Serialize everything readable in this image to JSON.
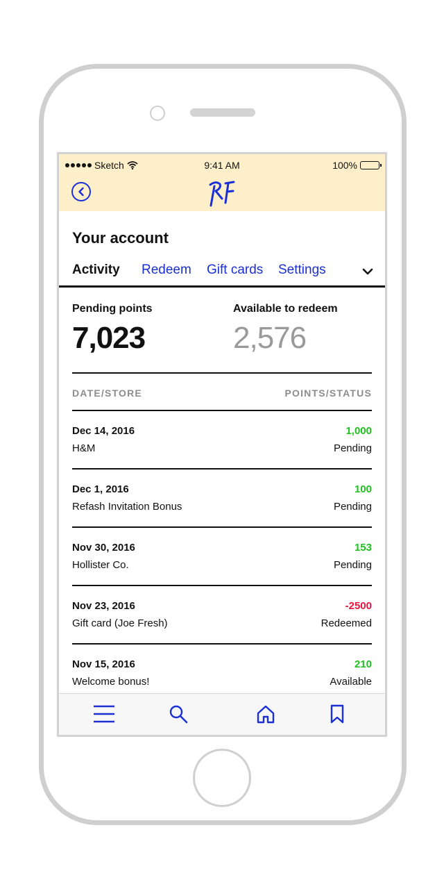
{
  "colors": {
    "accent": "#1a2fd6",
    "header_bg": "#fcefca",
    "positive": "#1fc21f",
    "negative": "#e8143c",
    "muted": "#9a9a9a"
  },
  "status_bar": {
    "carrier": "Sketch",
    "time": "9:41 AM",
    "battery": "100%",
    "battery_level": 1.0
  },
  "header": {
    "back_icon": "chevron-left-circle-icon",
    "logo_icon": "rf-logo-icon"
  },
  "page": {
    "title": "Your account"
  },
  "tabs": [
    {
      "label": "Activity",
      "active": true
    },
    {
      "label": "Redeem",
      "active": false
    },
    {
      "label": "Gift cards",
      "active": false
    },
    {
      "label": "Settings",
      "active": false
    }
  ],
  "tabs_more_icon": "chevron-down-icon",
  "summary": {
    "pending_label": "Pending points",
    "pending_value": "7,023",
    "available_label": "Available to redeem",
    "available_value": "2,576"
  },
  "table": {
    "columns": [
      "DATE/STORE",
      "POINTS/STATUS"
    ],
    "rows": [
      {
        "date": "Dec 14, 2016",
        "store": "H&M",
        "points": "1,000",
        "status": "Pending",
        "tone": "positive"
      },
      {
        "date": "Dec 1, 2016",
        "store": "Refash Invitation Bonus",
        "points": "100",
        "status": "Pending",
        "tone": "positive"
      },
      {
        "date": "Nov 30, 2016",
        "store": "Hollister Co.",
        "points": "153",
        "status": "Pending",
        "tone": "positive"
      },
      {
        "date": "Nov 23, 2016",
        "store": "Gift card (Joe Fresh)",
        "points": "-2500",
        "status": "Redeemed",
        "tone": "negative"
      },
      {
        "date": "Nov 15, 2016",
        "store": "Welcome bonus!",
        "points": "210",
        "status": "Available",
        "tone": "positive"
      }
    ]
  },
  "tab_bar": [
    {
      "icon": "menu-icon"
    },
    {
      "icon": "search-icon"
    },
    {
      "icon": "home-icon"
    },
    {
      "icon": "bookmark-icon"
    }
  ]
}
